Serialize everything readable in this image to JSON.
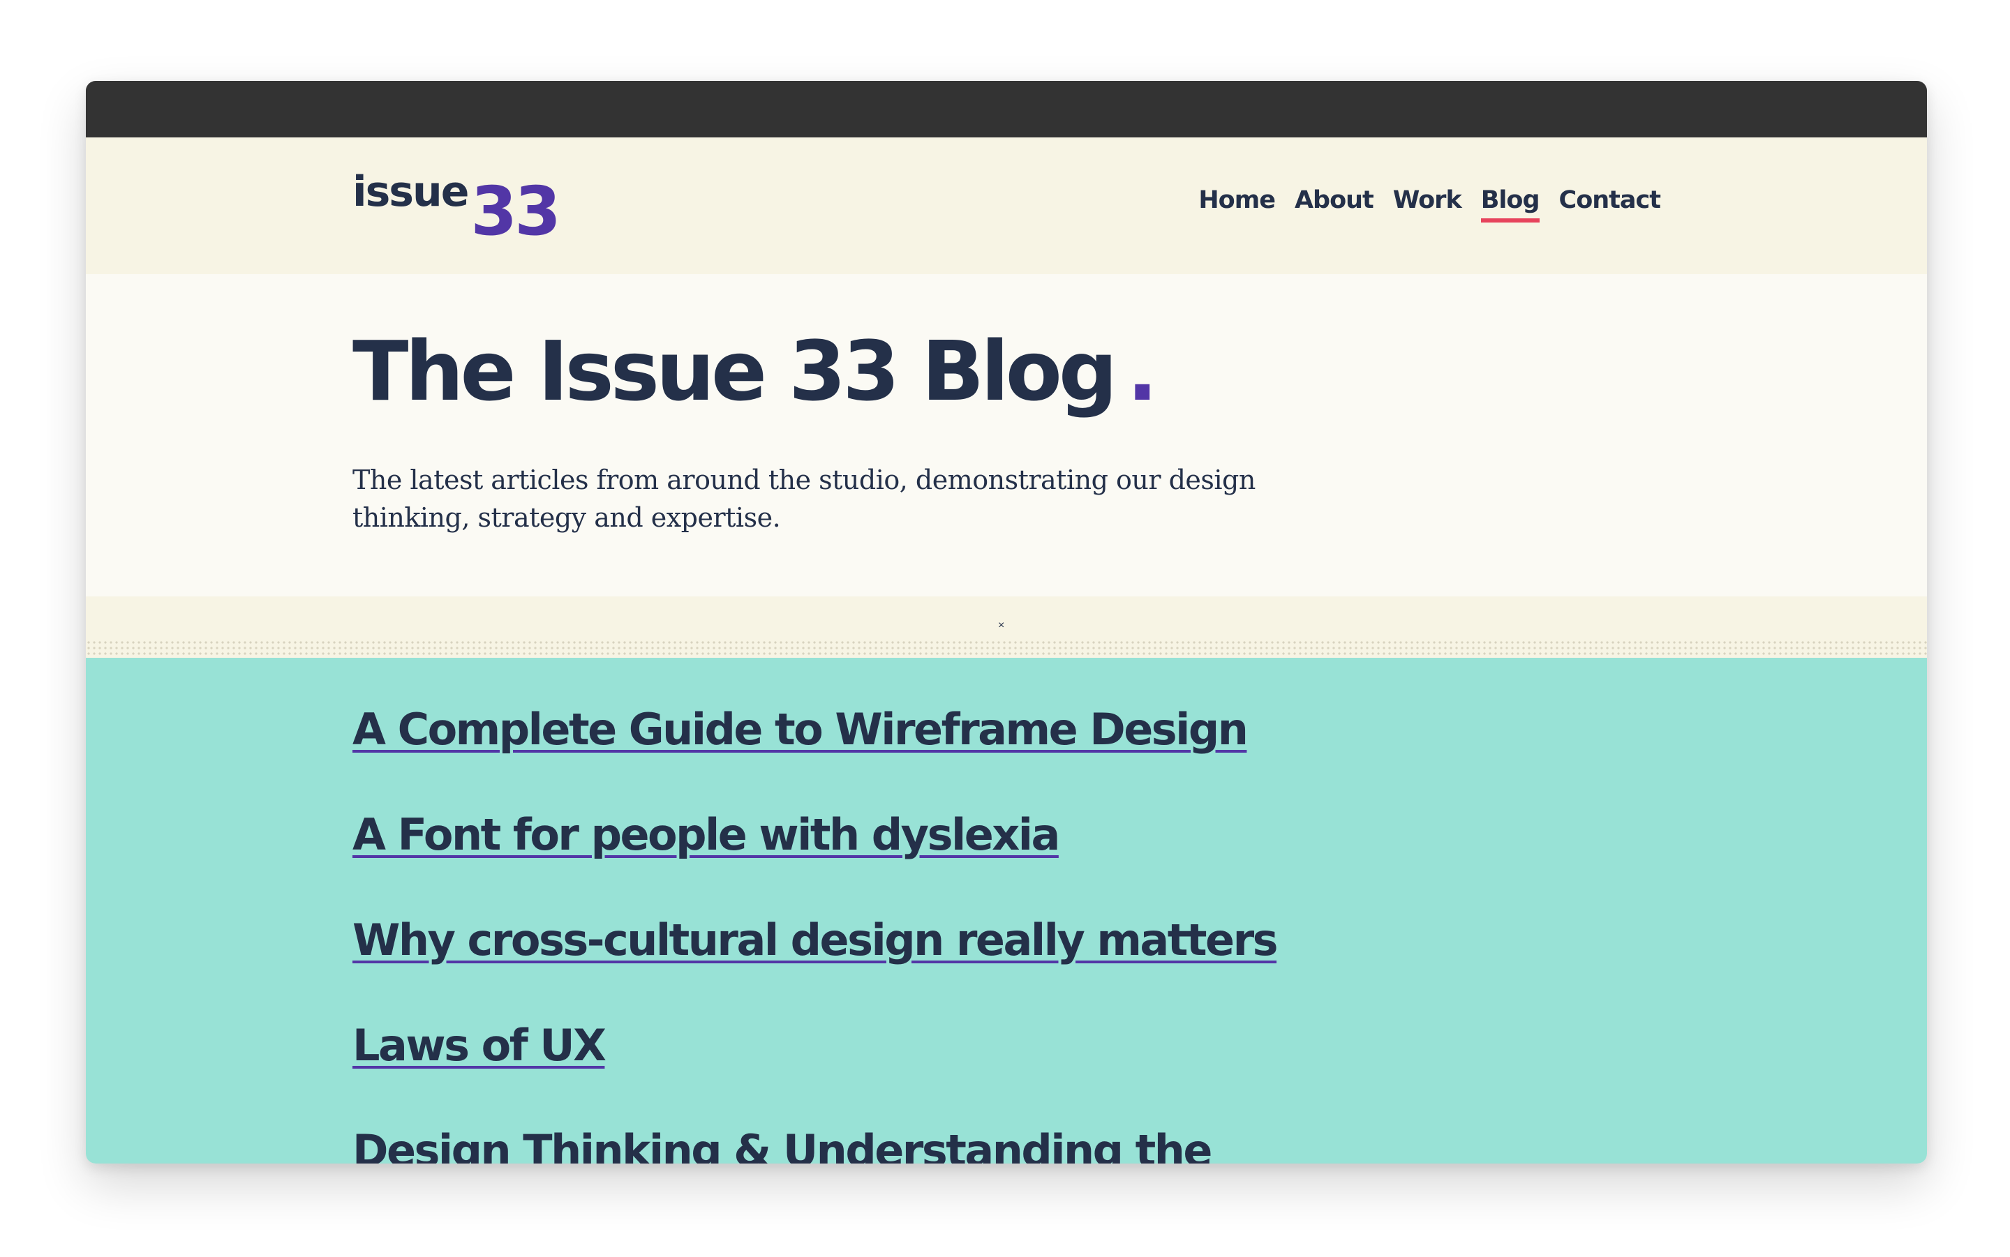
{
  "header": {
    "logo_word": "issue",
    "logo_number": "33",
    "nav": [
      {
        "label": "Home"
      },
      {
        "label": "About"
      },
      {
        "label": "Work"
      },
      {
        "label": "Blog"
      },
      {
        "label": "Contact"
      }
    ],
    "active_nav": "Blog"
  },
  "hero": {
    "title": "The Issue 33 Blog",
    "title_dot": ".",
    "subtitle": "The latest articles from around the studio, demonstrating our design thinking, strategy and expertise."
  },
  "divider": {
    "mark": "×"
  },
  "articles": [
    {
      "title": "A Complete Guide to Wireframe Design"
    },
    {
      "title": "A Font for people with dyslexia"
    },
    {
      "title": "Why cross-cultural design really matters"
    },
    {
      "title": "Laws of UX"
    },
    {
      "title": "Design Thinking & Understanding the"
    }
  ],
  "colors": {
    "titlebar": "#333333",
    "header_bg": "#f7f4e4",
    "hero_bg": "#fbfaf4",
    "articles_bg": "#98e2d6",
    "text_navy": "#243049",
    "accent_purple": "#5236a6",
    "nav_active_underline": "#e7435c"
  }
}
